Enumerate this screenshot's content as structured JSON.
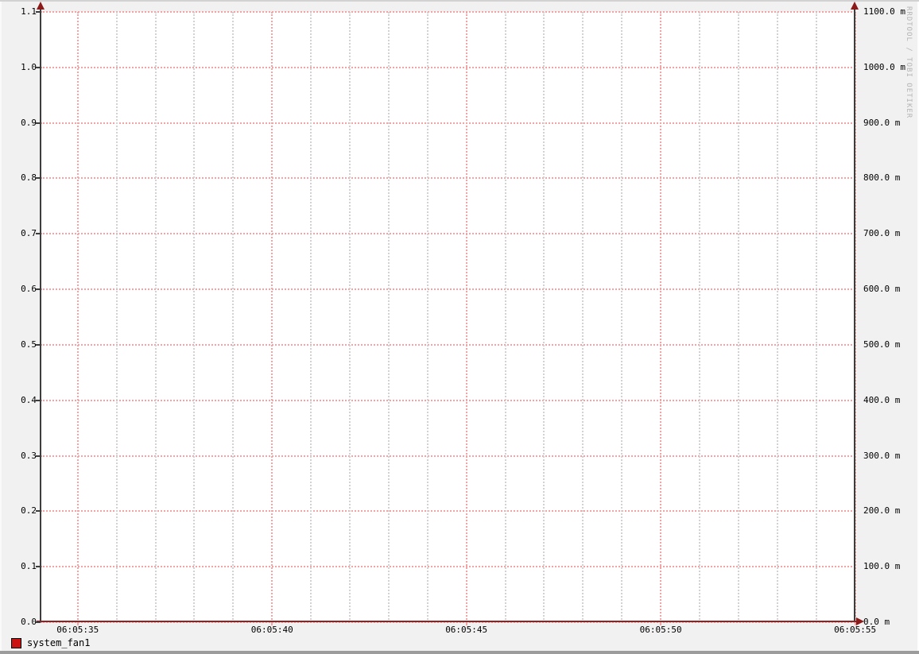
{
  "watermark": "RRDTOOL / TOBI OETIKER",
  "chart_data": {
    "type": "line",
    "title": "",
    "x_axis": {
      "ticks": [
        "06:05:35",
        "06:05:40",
        "06:05:45",
        "06:05:50",
        "06:05:55"
      ],
      "minor_per_major": 4,
      "minor_step_seconds": 1,
      "major_step_seconds": 5
    },
    "left_axis": {
      "ticks": [
        "1.1",
        "1.0",
        "0.9",
        "0.8",
        "0.7",
        "0.6",
        "0.5",
        "0.4",
        "0.3",
        "0.2",
        "0.1",
        "0.0"
      ],
      "min": 0.0,
      "max": 1.1
    },
    "right_axis": {
      "ticks": [
        "1100.0 m",
        "1000.0 m",
        "900.0 m",
        "800.0 m",
        "700.0 m",
        "600.0 m",
        "500.0 m",
        "400.0 m",
        "300.0 m",
        "200.0 m",
        "100.0 m",
        "0.0 m"
      ],
      "min": 0,
      "max": 1100,
      "unit": "m"
    },
    "series": [
      {
        "name": "system_fan1",
        "color": "#cc1111",
        "x": [
          "06:05:35",
          "06:05:40",
          "06:05:45",
          "06:05:50",
          "06:05:55"
        ],
        "y": [
          0,
          0,
          0,
          0,
          0
        ]
      }
    ],
    "grid": {
      "major_color": "#f2a4a4",
      "minor_color": "#d2d2d2",
      "grid_on": true
    },
    "legend_position": "bottom-left",
    "ylim_left": [
      0.0,
      1.1
    ],
    "ylim_right": [
      0,
      1100
    ]
  },
  "legend": {
    "items": [
      {
        "label": "system_fan1",
        "swatch_color": "#cc1111"
      }
    ]
  },
  "colors": {
    "background": "#f1f1f1",
    "plot_background": "#ffffff",
    "axis": "#3d3d3d",
    "arrow": "#8b1a1a",
    "watermark_text": "#b4b4b4",
    "series_red": "#cc1111"
  }
}
